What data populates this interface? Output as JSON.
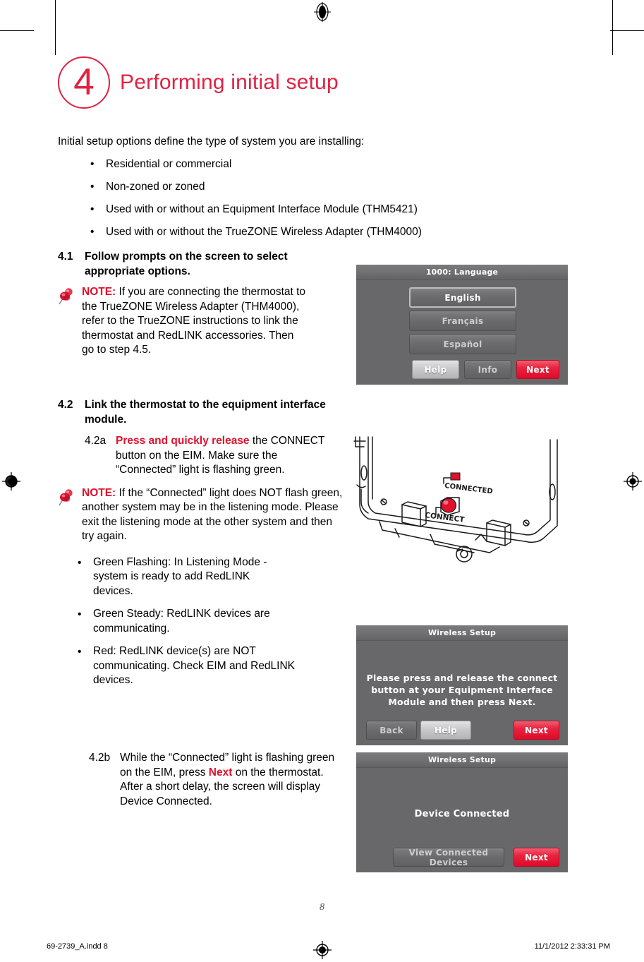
{
  "chapter": {
    "number": "4",
    "title": "Performing initial setup"
  },
  "intro": {
    "text": "Initial setup options define the type of system you are installing:",
    "bullets": [
      "Residential or commercial",
      "Non-zoned or zoned",
      "Used with or without an Equipment Interface Module (THM5421)",
      "Used with or without the TrueZONE Wireless Adapter (THM4000)"
    ],
    "bullet_glyph": "•"
  },
  "steps": {
    "s41": {
      "number": "4.1",
      "heading": "Follow prompts on the screen to select appropriate options.",
      "note_label": "NOTE:",
      "note_text": " If you are connecting the thermostat to the TrueZONE Wireless Adapter (THM4000), refer to the TrueZONE instructions to link the thermostat and RedLINK accessories. Then go to step 4.5."
    },
    "s42": {
      "number": "4.2",
      "heading": "Link the thermostat to the equipment interface module.",
      "a": {
        "number": "4.2a",
        "emphasis": "Press and quickly release",
        "text": " the CONNECT button on the EIM. Make sure the “Connected” light is flashing green."
      },
      "note_label": "NOTE:",
      "note_text": " If the “Connected” light does NOT flash green, another system may be in the listening mode. Please exit the listening mode at the other system and then try again.",
      "led_bullets": [
        "Green Flashing: In Listening Mode - system is ready to add RedLINK devices.",
        "Green Steady: RedLINK devices are communicating.",
        "Red: RedLINK device(s) are NOT communicating. Check EIM and RedLINK devices."
      ],
      "b": {
        "number": "4.2b",
        "text_before": "While the “Connected” light is flashing green on the EIM, press ",
        "emphasis": "Next",
        "text_after": " on the thermostat. After a short delay, the screen will display Device Connected."
      }
    }
  },
  "screens": {
    "language": {
      "title": "1000: Language",
      "options": [
        {
          "label": "English",
          "selected": true
        },
        {
          "label": "Français",
          "selected": false
        },
        {
          "label": "Español",
          "selected": false
        }
      ],
      "buttons": [
        {
          "label": "Help",
          "style": "light"
        },
        {
          "label": "Info",
          "style": "dark"
        },
        {
          "label": "Next",
          "style": "next"
        }
      ]
    },
    "wireless_setup_prompt": {
      "title": "Wireless Setup",
      "message": "Please press and release the connect button at your Equipment Interface Module and then press Next.",
      "buttons": [
        {
          "label": "Back",
          "style": "dark"
        },
        {
          "label": "Help",
          "style": "light"
        },
        {
          "label": "Next",
          "style": "next"
        }
      ]
    },
    "wireless_setup_connected": {
      "title": "Wireless Setup",
      "message": "Device Connected",
      "buttons": [
        {
          "label": "View Connected Devices",
          "style": "dark"
        },
        {
          "label": "Next",
          "style": "next"
        }
      ]
    }
  },
  "eim_diagram": {
    "led_label": "CONNECTED",
    "button_label": "CONNECT"
  },
  "footer": {
    "page_number": "8",
    "file_name": "69-2739_A.indd   8",
    "timestamp": "11/1/2012   2:33:31 PM"
  },
  "colors": {
    "brand_red": "#e02243",
    "note_red": "#e0112b",
    "screen_gray": "#68686a"
  }
}
